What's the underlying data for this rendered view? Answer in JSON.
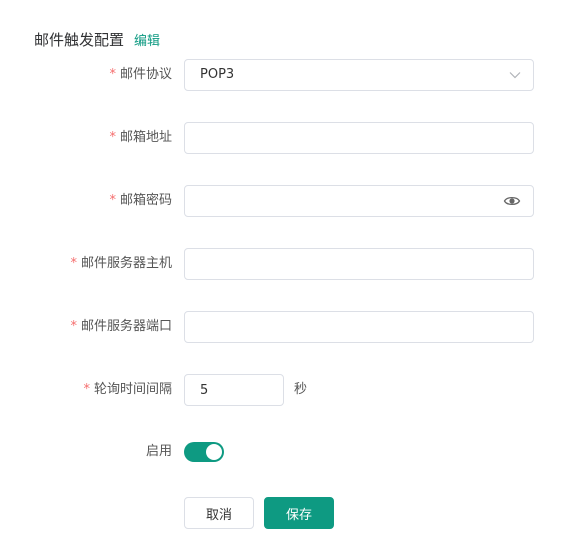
{
  "header": {
    "title": "邮件触发配置",
    "edit_label": "编辑"
  },
  "form": {
    "protocol": {
      "label": "邮件协议",
      "value": "POP3"
    },
    "email": {
      "label": "邮箱地址",
      "value": ""
    },
    "password": {
      "label": "邮箱密码",
      "value": ""
    },
    "server_host": {
      "label": "邮件服务器主机",
      "value": ""
    },
    "server_port": {
      "label": "邮件服务器端口",
      "value": ""
    },
    "poll_interval": {
      "label": "轮询时间间隔",
      "value": "5",
      "unit": "秒"
    },
    "enabled": {
      "label": "启用",
      "on": true
    },
    "required_mark": "*"
  },
  "actions": {
    "cancel_label": "取消",
    "save_label": "保存"
  },
  "colors": {
    "accent": "#0e9a82",
    "required": "#f56c6c",
    "border": "#dcdfe6"
  },
  "icons": {
    "select": "chevron-down-icon",
    "password": "eye-icon"
  }
}
